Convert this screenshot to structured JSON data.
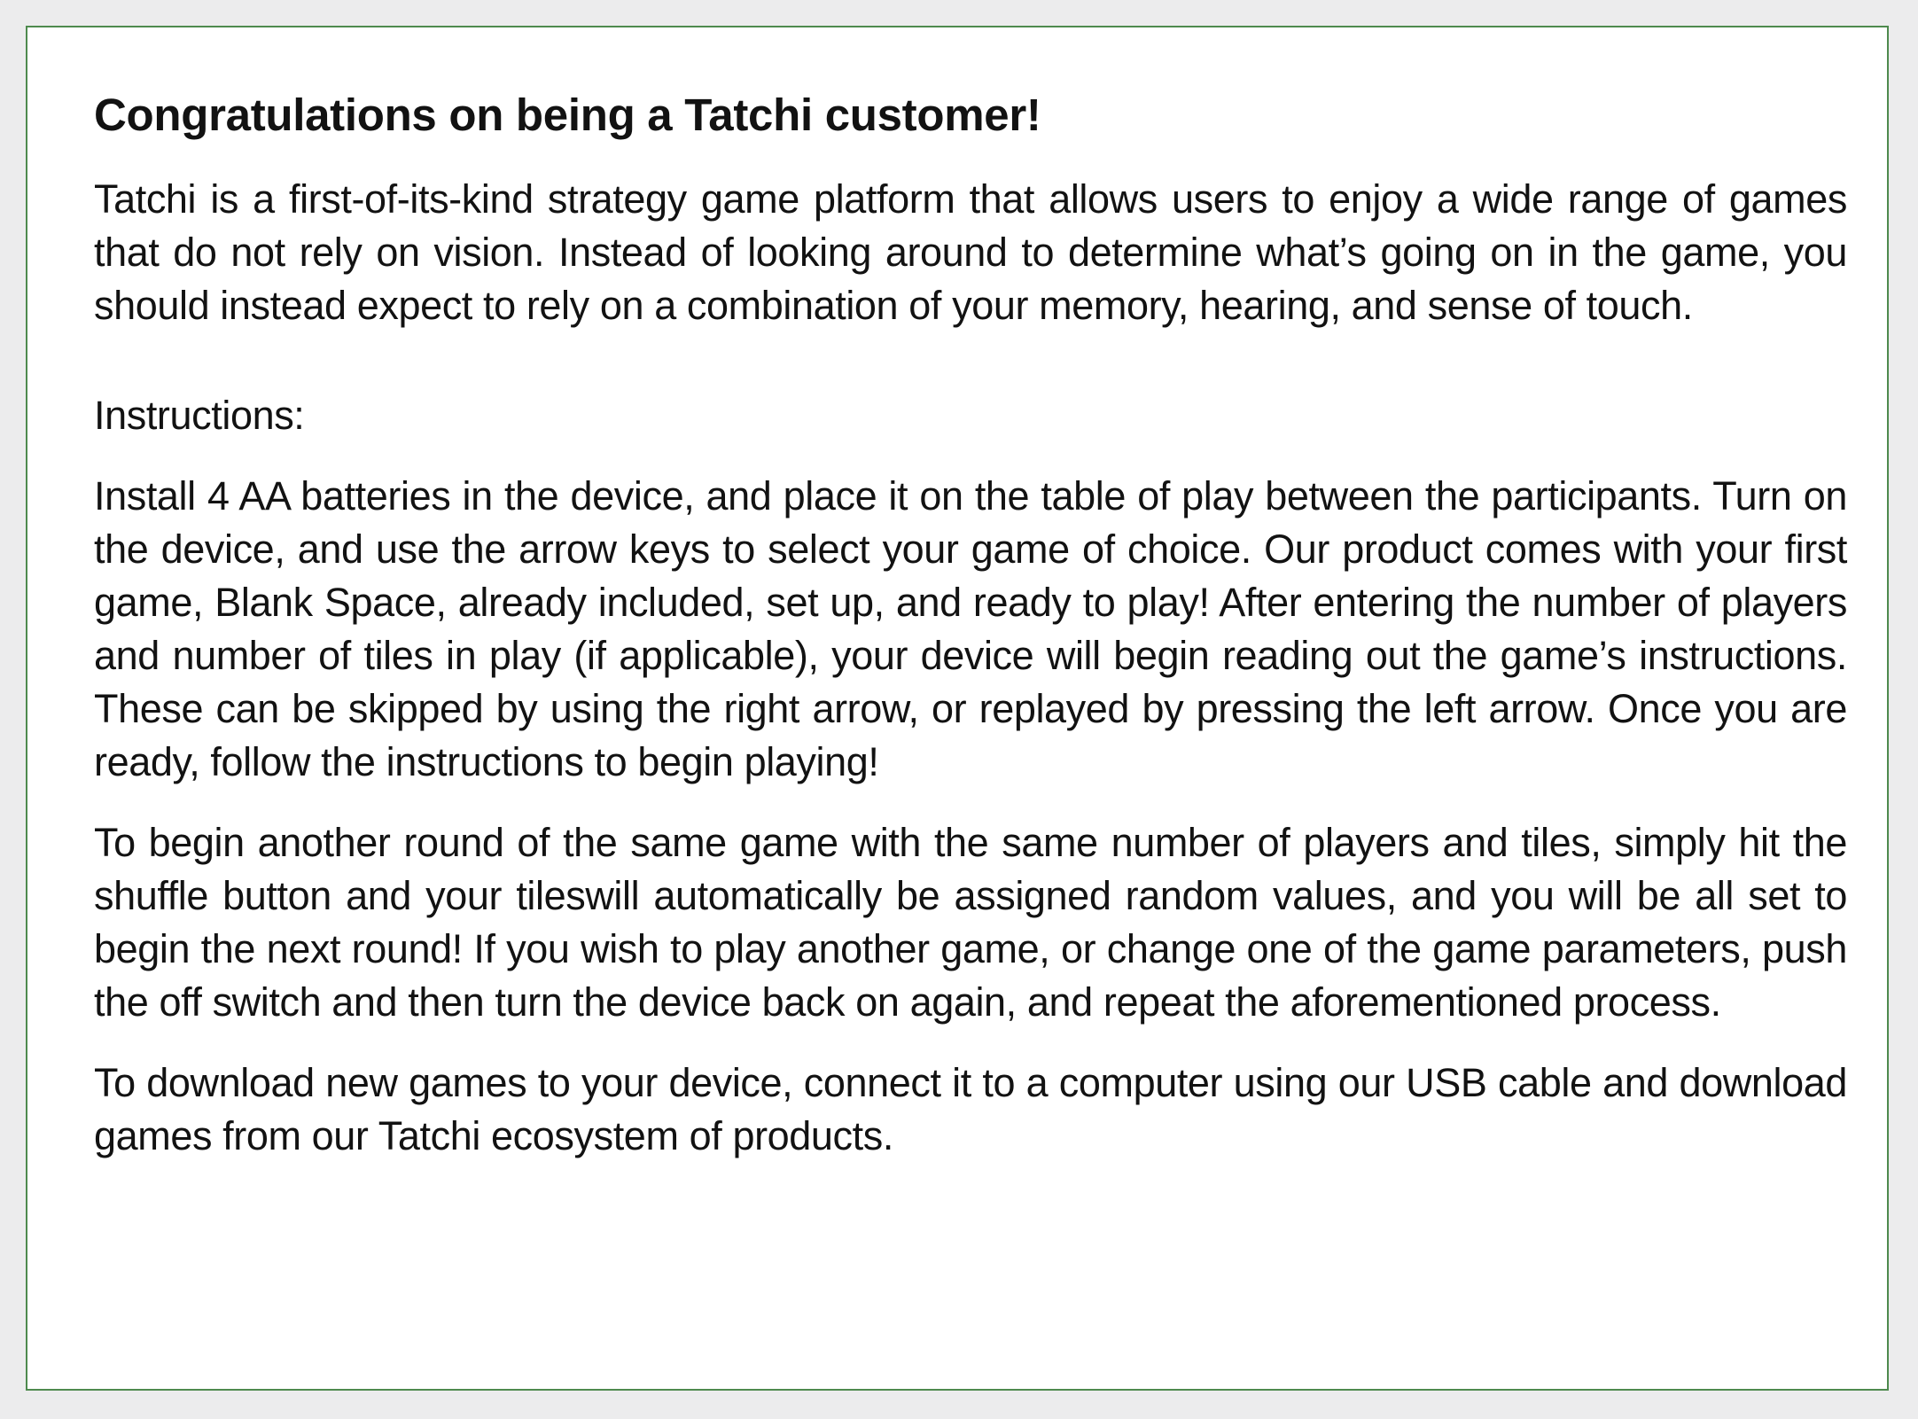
{
  "document": {
    "title": "Congratulations on being a Tatchi customer!",
    "intro": "Tatchi is a first-of-its-kind strategy game platform that allows users to enjoy a wide range of games that do not rely on vision. Instead of looking around to determine what’s going on in the game, you should instead expect to rely on a combination of your memory, hearing, and sense of touch.",
    "instructions_heading": "Instructions:",
    "paragraphs": [
      "Install 4 AA batteries in the device, and place it on the table of play between the participants. Turn on the device, and use the arrow keys to select your game of choice. Our product comes with your first game, Blank Space, already included, set up, and ready to play! After entering the number of players and number of tiles in play (if applicable), your device will begin reading out the game’s instructions. These can be skipped by using the right arrow, or replayed by pressing the left arrow. Once you are ready, follow the instructions to begin playing!",
      "To begin another round of the same game with the same number of players and tiles, simply hit the shuffle button and your tileswill automatically be assigned random values, and you will be all set to begin the next round! If you wish to play another game, or change one of the game parameters, push the off switch and then turn the device back on again, and repeat the aforementioned process.",
      "To download new games to your device, connect it to a computer using our USB cable and download games from our Tatchi ecosystem of products."
    ]
  },
  "colors": {
    "page_background": "#ececed",
    "panel_background": "#ffffff",
    "panel_border": "#4e8a4e",
    "text": "#121212"
  }
}
